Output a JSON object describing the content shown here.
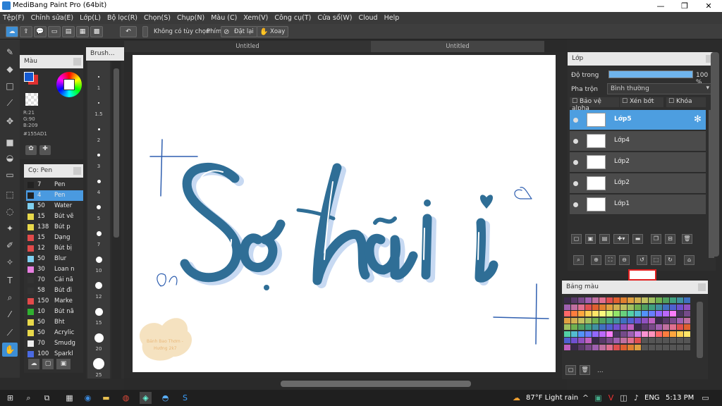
{
  "window": {
    "title": "MediBang Paint Pro (64bit)"
  },
  "menu": [
    "Tệp(F)",
    "Chỉnh sửa(E)",
    "Lớp(L)",
    "Bộ lọc(R)",
    "Chọn(S)",
    "Chụp(N)",
    "Màu (C)",
    "Xem(V)",
    "Công cụ(T)",
    "Cửa sổ(W)",
    "Cloud",
    "Help"
  ],
  "toolbar": {
    "no_options_label": "Không có tùy chọn",
    "key_label": "Phím",
    "reset_label": "Đặt lại",
    "rotate_label": "Xoay"
  },
  "tabs": [
    "Untitled",
    "Untitled"
  ],
  "color_panel": {
    "title": "Màu",
    "r": "R:21",
    "g": "G:90",
    "b": "B:209",
    "hex": "#155AD1",
    "primary": "#155AD1",
    "secondary": "#E03030"
  },
  "brush_size_panel": {
    "title": "Brush...",
    "sizes": [
      "1",
      "1.5",
      "2",
      "3",
      "4",
      "5",
      "7",
      "10",
      "12",
      "15",
      "20",
      "25"
    ]
  },
  "brush_panel": {
    "title": "Cọ: Pen",
    "items": [
      {
        "size": "7",
        "name": "Pen",
        "color": "#222222"
      },
      {
        "size": "4",
        "name": "Pen",
        "color": "#222222"
      },
      {
        "size": "50",
        "name": "Water",
        "color": "#7fd0f0"
      },
      {
        "size": "15",
        "name": "Bút vẽ",
        "color": "#e8d84a"
      },
      {
        "size": "138",
        "name": "Bút p",
        "color": "#e8d84a"
      },
      {
        "size": "15",
        "name": "Dạng",
        "color": "#e24a4a"
      },
      {
        "size": "12",
        "name": "Bút bị",
        "color": "#e24a4a"
      },
      {
        "size": "50",
        "name": "Blur",
        "color": "#7fd0f0"
      },
      {
        "size": "30",
        "name": "Loan n",
        "color": "#e87fe0"
      },
      {
        "size": "70",
        "name": "Cái nă",
        "color": "#333333"
      },
      {
        "size": "58",
        "name": "Bút đi",
        "color": "#333333"
      },
      {
        "size": "150",
        "name": "Marke",
        "color": "#e24a4a"
      },
      {
        "size": "10",
        "name": "Bút nă",
        "color": "#30b030"
      },
      {
        "size": "50",
        "name": "Bht",
        "color": "#e8d84a"
      },
      {
        "size": "50",
        "name": "Acrylic",
        "color": "#e8d84a"
      },
      {
        "size": "70",
        "name": "Smudg",
        "color": "#eeeeee"
      },
      {
        "size": "100",
        "name": "Sparkl",
        "color": "#4a6ae2"
      }
    ]
  },
  "layer_panel": {
    "title": "Lớp",
    "opacity_label": "Độ trong",
    "opacity_value": "100 %",
    "opacity_fraction": 1.0,
    "blend_label": "Pha trộn",
    "blend_value": "Bình thường",
    "protect_alpha": "Bảo vệ alpha",
    "clipping": "Xén bớt",
    "lock": "Khóa",
    "layers": [
      "Lớp5",
      "Lớp4",
      "Lớp2",
      "Lớp2",
      "Lớp1"
    ]
  },
  "palette_panel": {
    "title": "Bảng màu",
    "bottom_text": "..."
  },
  "canvas": {
    "lettering": "Sợ hãi",
    "watermark": "Bánh Bao Thơm - Hướng 2k7",
    "stroke_color": "#2f6e96",
    "shadow_color": "#c7d9f2"
  },
  "taskbar": {
    "weather": "87°F  Light rain",
    "lang": "ENG",
    "time": "5:13 PM"
  }
}
